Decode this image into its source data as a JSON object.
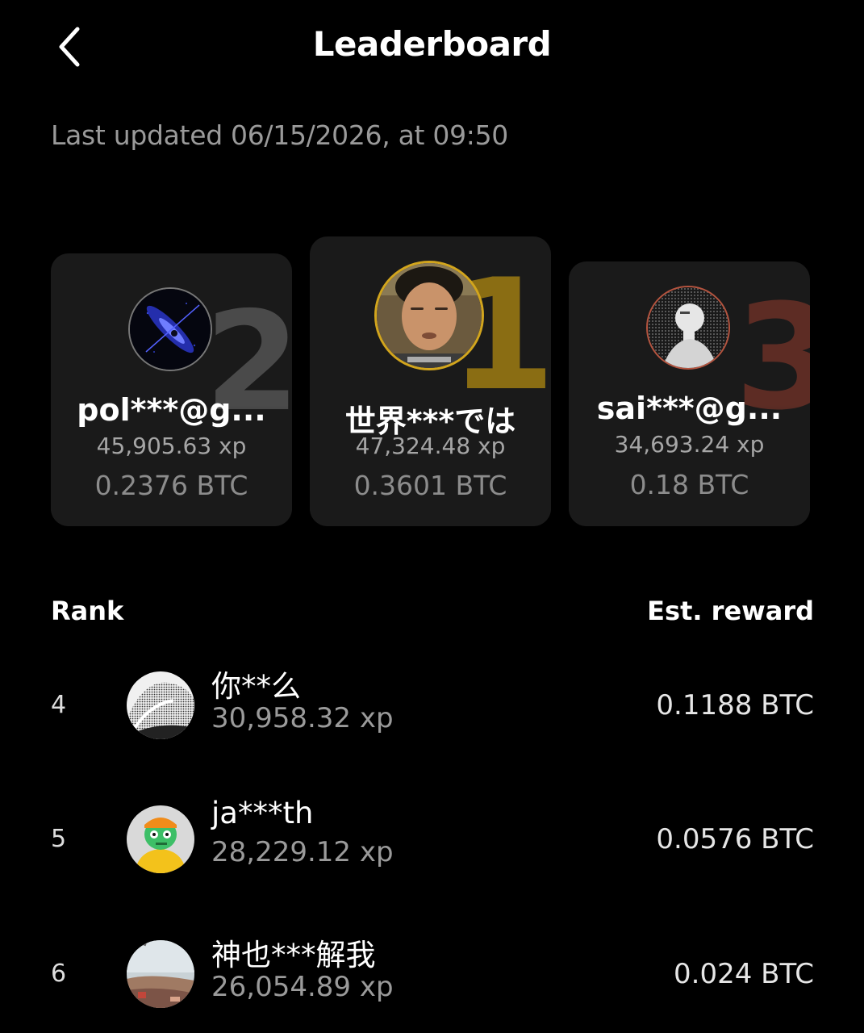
{
  "header": {
    "title": "Leaderboard",
    "back_icon": "chevron-left-icon",
    "last_updated": "Last updated 06/15/2026, at 09:50"
  },
  "podium": [
    {
      "place": "2",
      "name": "pol***@g...",
      "xp": "45,905.63 xp",
      "reward": "0.2376 BTC",
      "accent": "#777777"
    },
    {
      "place": "1",
      "name": "世界***では",
      "xp": "47,324.48 xp",
      "reward": "0.3601 BTC",
      "accent": "#d2a51d"
    },
    {
      "place": "3",
      "name": "sai***@g...",
      "xp": "34,693.24 xp",
      "reward": "0.18 BTC",
      "accent": "#b5543f"
    }
  ],
  "table": {
    "rank_header": "Rank",
    "reward_header": "Est. reward",
    "rows": [
      {
        "rank": "4",
        "name": "你**么",
        "xp": "30,958.32 xp",
        "reward": "0.1188 BTC"
      },
      {
        "rank": "5",
        "name": "ja***th",
        "xp": "28,229.12 xp",
        "reward": "0.0576 BTC"
      },
      {
        "rank": "6",
        "name": "神也***解我",
        "xp": "26,054.89 xp",
        "reward": "0.024 BTC"
      }
    ]
  },
  "colors": {
    "background": "#000000",
    "card": "#1a1a1a",
    "gold": "#d2a51d",
    "silver": "#777777",
    "bronze": "#b5543f"
  }
}
